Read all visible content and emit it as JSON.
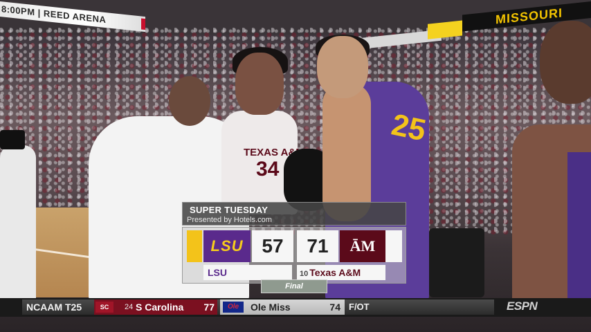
{
  "arena": {
    "ribbon_left": "8:00PM | REED ARENA",
    "ribbon_right": "MISSOURI"
  },
  "player": {
    "jersey_school": "TEXAS A&M",
    "jersey_number": "34",
    "lsu_number": "25"
  },
  "scoreboard": {
    "title": "SUPER TUESDAY",
    "subtitle": "Presented by Hotels.com",
    "away": {
      "logo_text": "LSU",
      "name": "LSU",
      "score": "57",
      "color": "#5a2a8c",
      "accent": "#f3c31a"
    },
    "home": {
      "logo_text": "ĀM",
      "rank": "10",
      "name": "Texas A&M",
      "score": "71",
      "color": "#5b0a1a"
    },
    "status": "Final"
  },
  "ticker": {
    "league": "NCAAM T25",
    "game1": {
      "logo_text": "SC",
      "rank": "24",
      "team": "S Carolina",
      "score": "77"
    },
    "game2": {
      "logo_text": "Ole",
      "team": "Ole Miss",
      "score": "74"
    },
    "status": "F/OT"
  },
  "network": "ESPN"
}
